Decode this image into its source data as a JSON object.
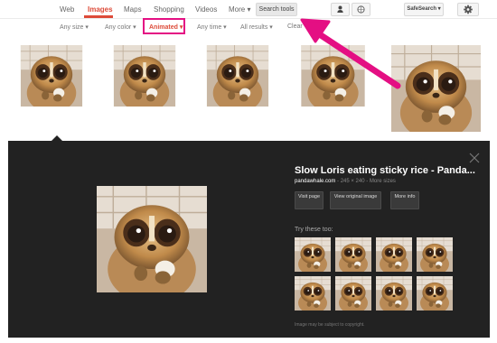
{
  "nav": {
    "tabs": [
      {
        "label": "Web"
      },
      {
        "label": "Images"
      },
      {
        "label": "Maps"
      },
      {
        "label": "Shopping"
      },
      {
        "label": "Videos"
      },
      {
        "label": "More ▾"
      }
    ],
    "search_tools_label": "Search tools",
    "safesearch_label": "SafeSearch ▾"
  },
  "filters": [
    {
      "label": "Any size ▾"
    },
    {
      "label": "Any color ▾"
    },
    {
      "label": "Animated ▾"
    },
    {
      "label": "Any time ▾"
    },
    {
      "label": "All results ▾"
    },
    {
      "label": "Clear"
    }
  ],
  "preview": {
    "title": "Slow Loris eating sticky rice - Panda...",
    "site": "pandawhale.com",
    "meta": " - 245 × 240 - More sizes",
    "buttons": [
      {
        "label": "Visit page"
      },
      {
        "label": "View original image"
      },
      {
        "label": "More info"
      }
    ],
    "try_label": "Try these too:",
    "copyright": "Image may be subject to copyright."
  },
  "colors": {
    "accent": "#dd4b39",
    "annotation": "#e40f83",
    "panel_bg": "#222222"
  },
  "icons": [
    "person-icon",
    "globe-icon",
    "gear-icon",
    "close-icon",
    "annotation-arrow"
  ]
}
